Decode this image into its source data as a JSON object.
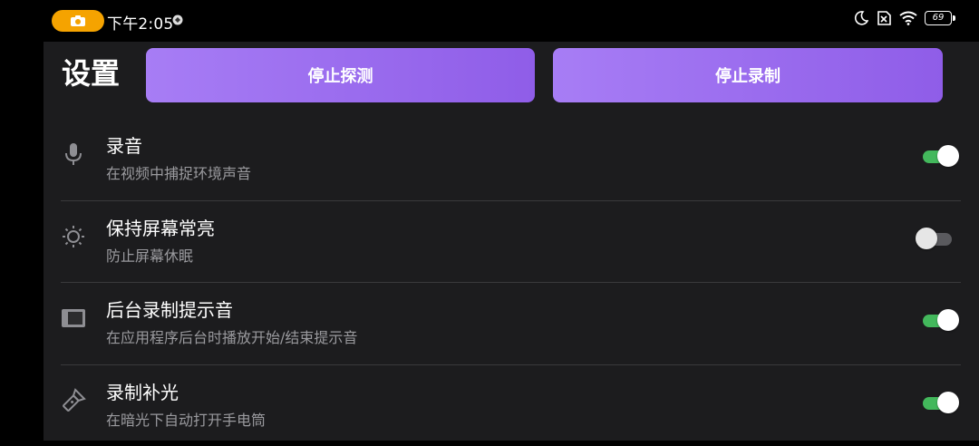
{
  "status_bar": {
    "time": "下午2:05",
    "battery": "69",
    "icons": [
      "camera-icon",
      "moon-icon",
      "sim-off-icon",
      "wifi-icon",
      "battery-icon"
    ]
  },
  "page": {
    "title": "设置"
  },
  "buttons": {
    "stop_detect": "停止探测",
    "stop_record": "停止录制"
  },
  "settings": [
    {
      "title": "录音",
      "subtitle": "在视频中捕捉环境声音",
      "icon": "microphone-icon",
      "enabled": true
    },
    {
      "title": "保持屏幕常亮",
      "subtitle": "防止屏幕休眠",
      "icon": "brightness-icon",
      "enabled": false
    },
    {
      "title": "后台录制提示音",
      "subtitle": "在应用程序后台时播放开始/结束提示音",
      "icon": "screen-icon",
      "enabled": true
    },
    {
      "title": "录制补光",
      "subtitle": "在暗光下自动打开手电筒",
      "icon": "flashlight-icon",
      "enabled": true
    }
  ],
  "colors": {
    "accent": "#9b6cf0",
    "toggle_on": "#43b85c",
    "status_pill": "#f5a300"
  }
}
